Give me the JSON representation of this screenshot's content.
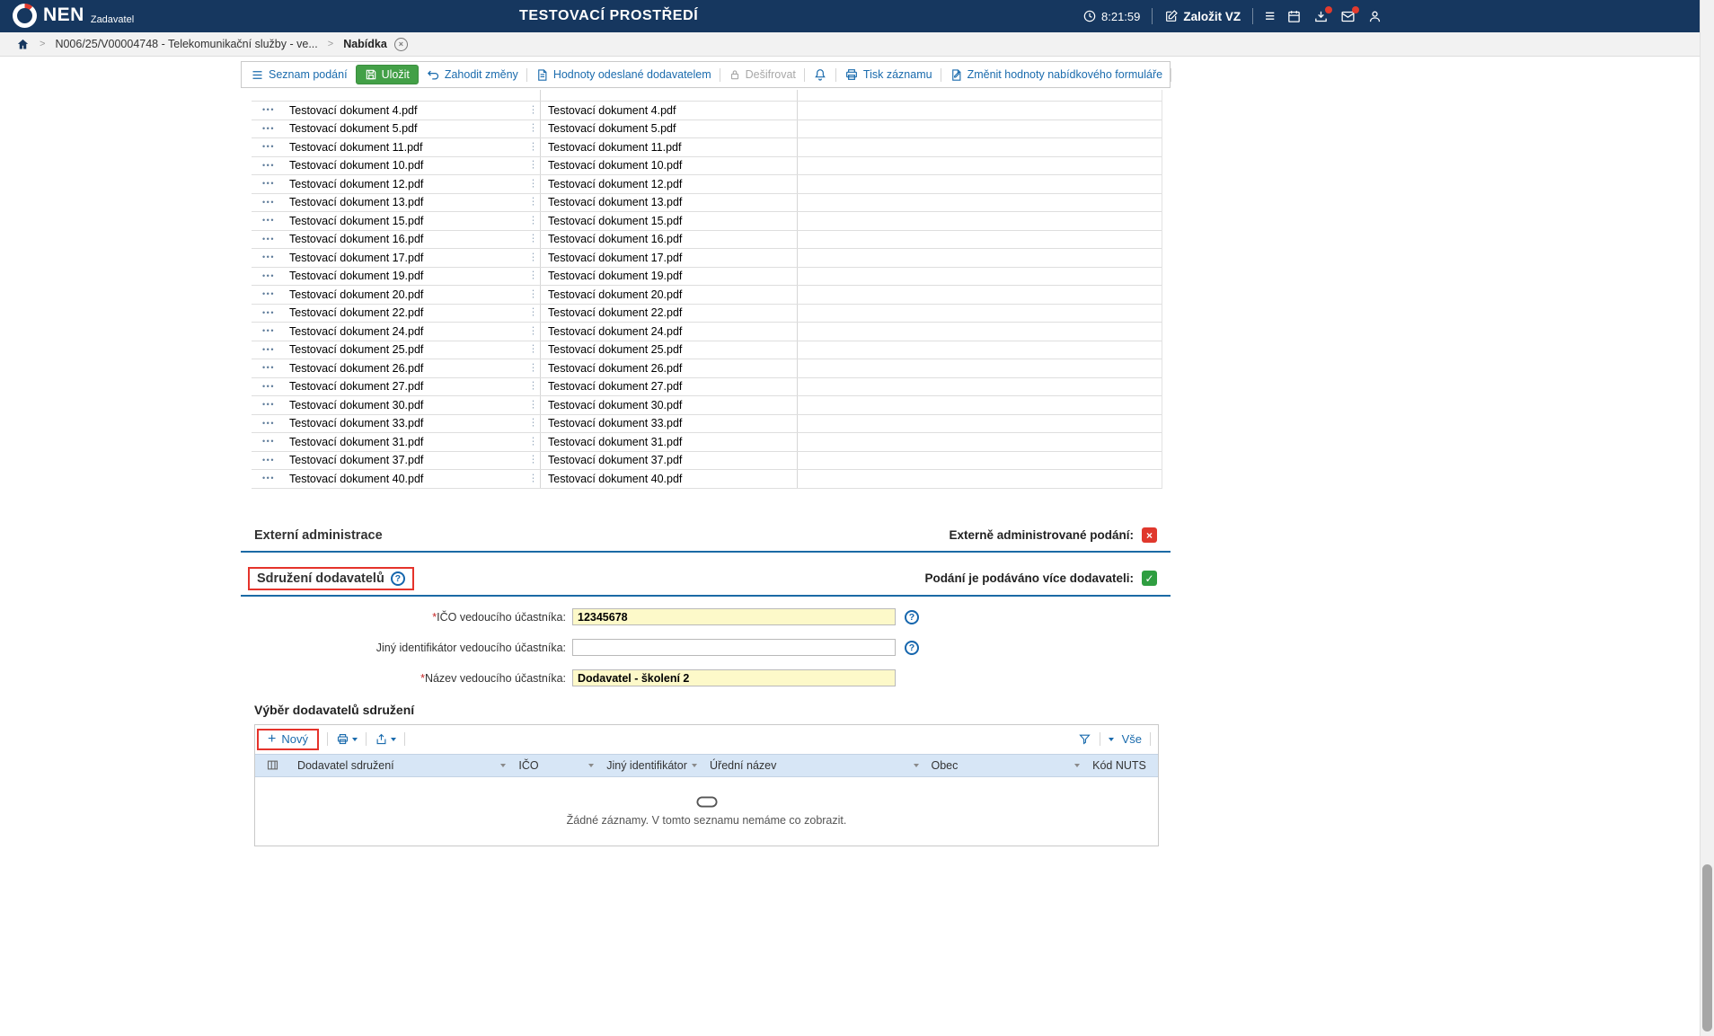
{
  "topbar": {
    "brand": "NEN",
    "brand_subtitle": "Zadavatel",
    "environment_title": "TESTOVACÍ PROSTŘEDÍ",
    "clock": "8:21:59",
    "create_vz_label": "Založit VZ"
  },
  "breadcrumb": {
    "contract": "N006/25/V00004748 - Telekomunikační služby - ve...",
    "current": "Nabídka"
  },
  "toolbar": {
    "seznam_podani": "Seznam podání",
    "ulozit": "Uložit",
    "zahodit_zmeny": "Zahodit změny",
    "hodnoty_odeslane": "Hodnoty odeslané dodavatelem",
    "desifrovat": "Dešifrovat",
    "tisk_zaznamu": "Tisk záznamu",
    "zmenit_hodnoty": "Změnit hodnoty nabídkového formuláře"
  },
  "documents": [
    "Testovací dokument 4.pdf",
    "Testovací dokument 5.pdf",
    "Testovací dokument 11.pdf",
    "Testovací dokument 10.pdf",
    "Testovací dokument 12.pdf",
    "Testovací dokument 13.pdf",
    "Testovací dokument 15.pdf",
    "Testovací dokument 16.pdf",
    "Testovací dokument 17.pdf",
    "Testovací dokument 19.pdf",
    "Testovací dokument 20.pdf",
    "Testovací dokument 22.pdf",
    "Testovací dokument 24.pdf",
    "Testovací dokument 25.pdf",
    "Testovací dokument 26.pdf",
    "Testovací dokument 27.pdf",
    "Testovací dokument 30.pdf",
    "Testovací dokument 33.pdf",
    "Testovací dokument 31.pdf",
    "Testovací dokument 37.pdf",
    "Testovací dokument 40.pdf"
  ],
  "externi": {
    "title": "Externí administrace",
    "checkbox_label": "Externě administrované podání:",
    "checkbox_state": "unchecked"
  },
  "sdruzeni": {
    "title": "Sdružení dodavatelů",
    "checkbox_label": "Podání je podáváno více dodavateli:",
    "checkbox_state": "checked",
    "required_marker": "*",
    "fields": {
      "ico": {
        "label": "IČO vedoucího účastníka:",
        "required": true,
        "value": "12345678"
      },
      "jiny_identifikator": {
        "label": "Jiný identifikátor vedoucího účastníka:",
        "required": false,
        "value": ""
      },
      "nazev": {
        "label": "Název vedoucího účastníka:",
        "required": true,
        "value": "Dodavatel - školení 2"
      }
    }
  },
  "vyber": {
    "title": "Výběr dodavatelů sdružení",
    "new_button": "Nový",
    "vse_label": "Vše",
    "columns": [
      "Dodavatel sdružení",
      "IČO",
      "Jiný identifikátor",
      "Úřední název",
      "Obec",
      "Kód NUTS"
    ],
    "empty_message": "Žádné záznamy. V tomto seznamu nemáme co zobrazit."
  },
  "icons": {
    "check": "✓",
    "cross": "×",
    "help": "?",
    "hamburger": "≡",
    "plus": "+",
    "handle": "⋮",
    "link_dots": "•••",
    "chevron": ">"
  },
  "colors": {
    "topbar": "#16375f",
    "accent_blue": "#1a6bad",
    "green_button": "#43a047",
    "section_line": "#1b6aa5",
    "required_bg": "#fdf9c9",
    "annotation_red": "#e5332b",
    "checkbox_red": "#e0382d",
    "checkbox_green": "#2f9e41"
  }
}
